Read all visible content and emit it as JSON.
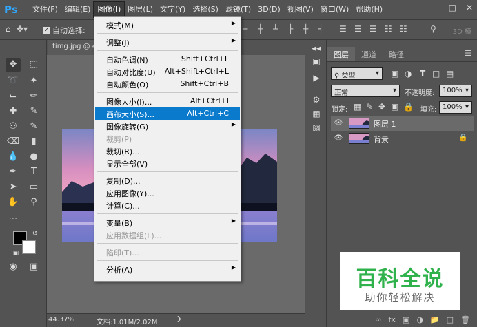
{
  "app": {
    "logo": "Ps"
  },
  "menubar": {
    "items": [
      "文件(F)",
      "编辑(E)",
      "图像(I)",
      "图层(L)",
      "文字(Y)",
      "选择(S)",
      "滤镜(T)",
      "3D(D)",
      "视图(V)",
      "窗口(W)",
      "帮助(H)"
    ],
    "active_index": 2
  },
  "options_bar": {
    "auto_select_label": "自动选择:",
    "three_d_label": "3D 模"
  },
  "document": {
    "tab_title": "timg.jpg @ 4",
    "zoom": "44.37%",
    "doc_size": "文档:1.01M/2.02M"
  },
  "image_menu": {
    "items": [
      {
        "label": "模式(M)",
        "submenu": true
      },
      {
        "separator": true
      },
      {
        "label": "调整(J)",
        "submenu": true
      },
      {
        "separator": true
      },
      {
        "label": "自动色调(N)",
        "shortcut": "Shift+Ctrl+L"
      },
      {
        "label": "自动对比度(U)",
        "shortcut": "Alt+Shift+Ctrl+L"
      },
      {
        "label": "自动颜色(O)",
        "shortcut": "Shift+Ctrl+B"
      },
      {
        "separator": true
      },
      {
        "label": "图像大小(I)...",
        "shortcut": "Alt+Ctrl+I"
      },
      {
        "label": "画布大小(S)...",
        "shortcut": "Alt+Ctrl+C",
        "highlighted": true
      },
      {
        "label": "图像旋转(G)",
        "submenu": true
      },
      {
        "label": "裁剪(P)",
        "disabled": true
      },
      {
        "label": "裁切(R)..."
      },
      {
        "label": "显示全部(V)"
      },
      {
        "separator": true
      },
      {
        "label": "复制(D)..."
      },
      {
        "label": "应用图像(Y)..."
      },
      {
        "label": "计算(C)..."
      },
      {
        "separator": true
      },
      {
        "label": "变量(B)",
        "submenu": true
      },
      {
        "label": "应用数据组(L)...",
        "disabled": true
      },
      {
        "separator": true
      },
      {
        "label": "陷印(T)...",
        "disabled": true
      },
      {
        "separator": true
      },
      {
        "label": "分析(A)",
        "submenu": true
      }
    ]
  },
  "layers_panel": {
    "tabs": [
      "图层",
      "通道",
      "路径"
    ],
    "active_tab": 0,
    "filter_kind": "类型",
    "blend_mode": "正常",
    "opacity_label": "不透明度:",
    "opacity_value": "100%",
    "lock_label": "锁定:",
    "fill_label": "填充:",
    "fill_value": "100%",
    "layers": [
      {
        "name": "图层 1",
        "selected": true,
        "locked": false
      },
      {
        "name": "背景",
        "selected": false,
        "locked": true
      }
    ]
  },
  "watermark": {
    "title": "百科全说",
    "subtitle": "助你轻松解决"
  },
  "colors": {
    "accent": "#0a7acd",
    "watermark_green": "#2fb14b",
    "ps_blue": "#31a8ff"
  }
}
